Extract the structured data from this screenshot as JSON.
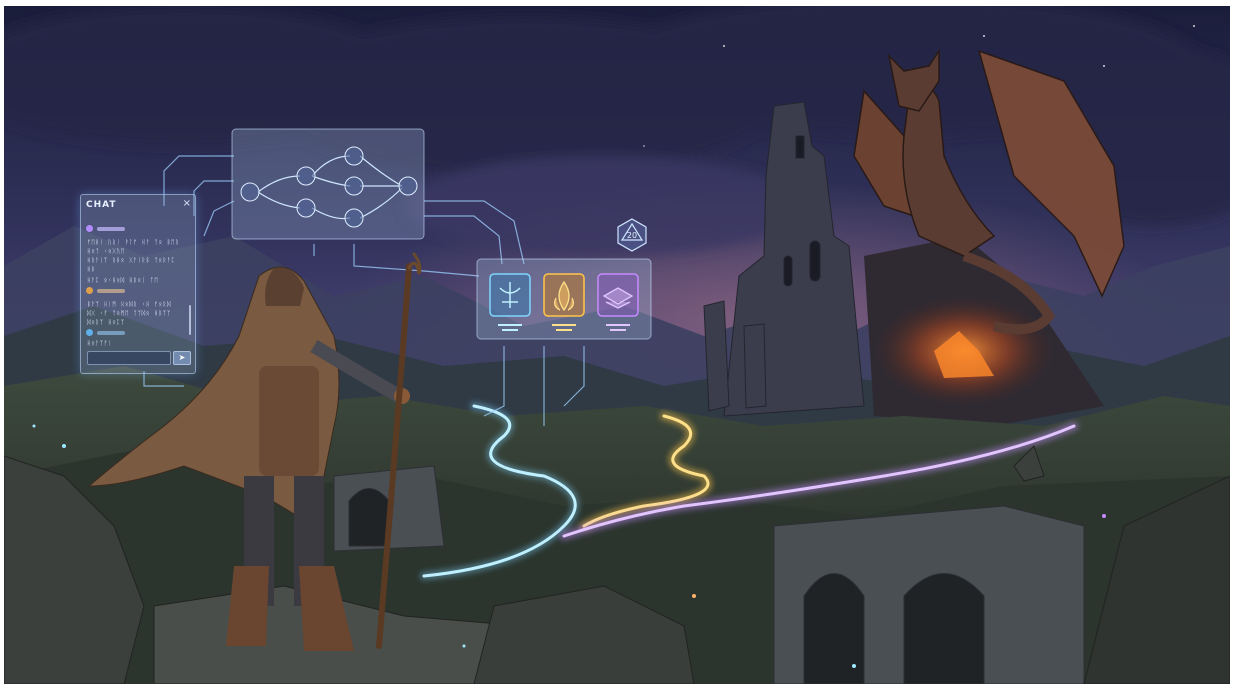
{
  "scene": {
    "chat_panel": {
      "title": "CHAT",
      "close_glyph": "×",
      "send_glyph": "➤",
      "messages": [
        {
          "lines": [
            "ᚠᛖᚺᛁ ᚢᚱᛁ ᚹᛚᚠ ᚺᚨ ᛏᛟ ᛒᛖᚱ",
            "ᚺᛟᛏ ᚲᛟᚷᚢᛖ",
            "ᚺᚱᚨᛁᛉ ᚱᚺᛟ ᚷᚨᛁᚱᛒ ᛏᛟᚱᚨᛈ",
            "ᚺᛒ",
            "ᚺᚨᛈ ᛟᚲᚺᛟᛞ ᚺᛒᛟᛁ ᛏᛖ"
          ]
        },
        {
          "lines": [
            "ᛒᚨᛉ ᚺᛁᛗ ᚺᛟᛞᚱ ᚲᚺ ᚠᛟᚱᛞ",
            "ᛞᚷ ᚲᚠ ᛏᛟᛗᛖ ᛏᛉᛞᛟ ᚺᛒᛉᛉ",
            "ᛞᛟᚱᛉ ᚺᛟᛈᛉ"
          ]
        },
        {
          "lines": [
            "ᚺᛟᚨᛉᚠᛁ"
          ]
        }
      ],
      "dot_colors": [
        "#b48cff",
        "#e0a04a",
        "#5fb0e8"
      ]
    },
    "dice_label": "20",
    "colors": {
      "blue_path": "#7fd6ff",
      "gold_path": "#ffc64a",
      "purple_path": "#c58cff",
      "lava": "#ff7a1e"
    }
  }
}
